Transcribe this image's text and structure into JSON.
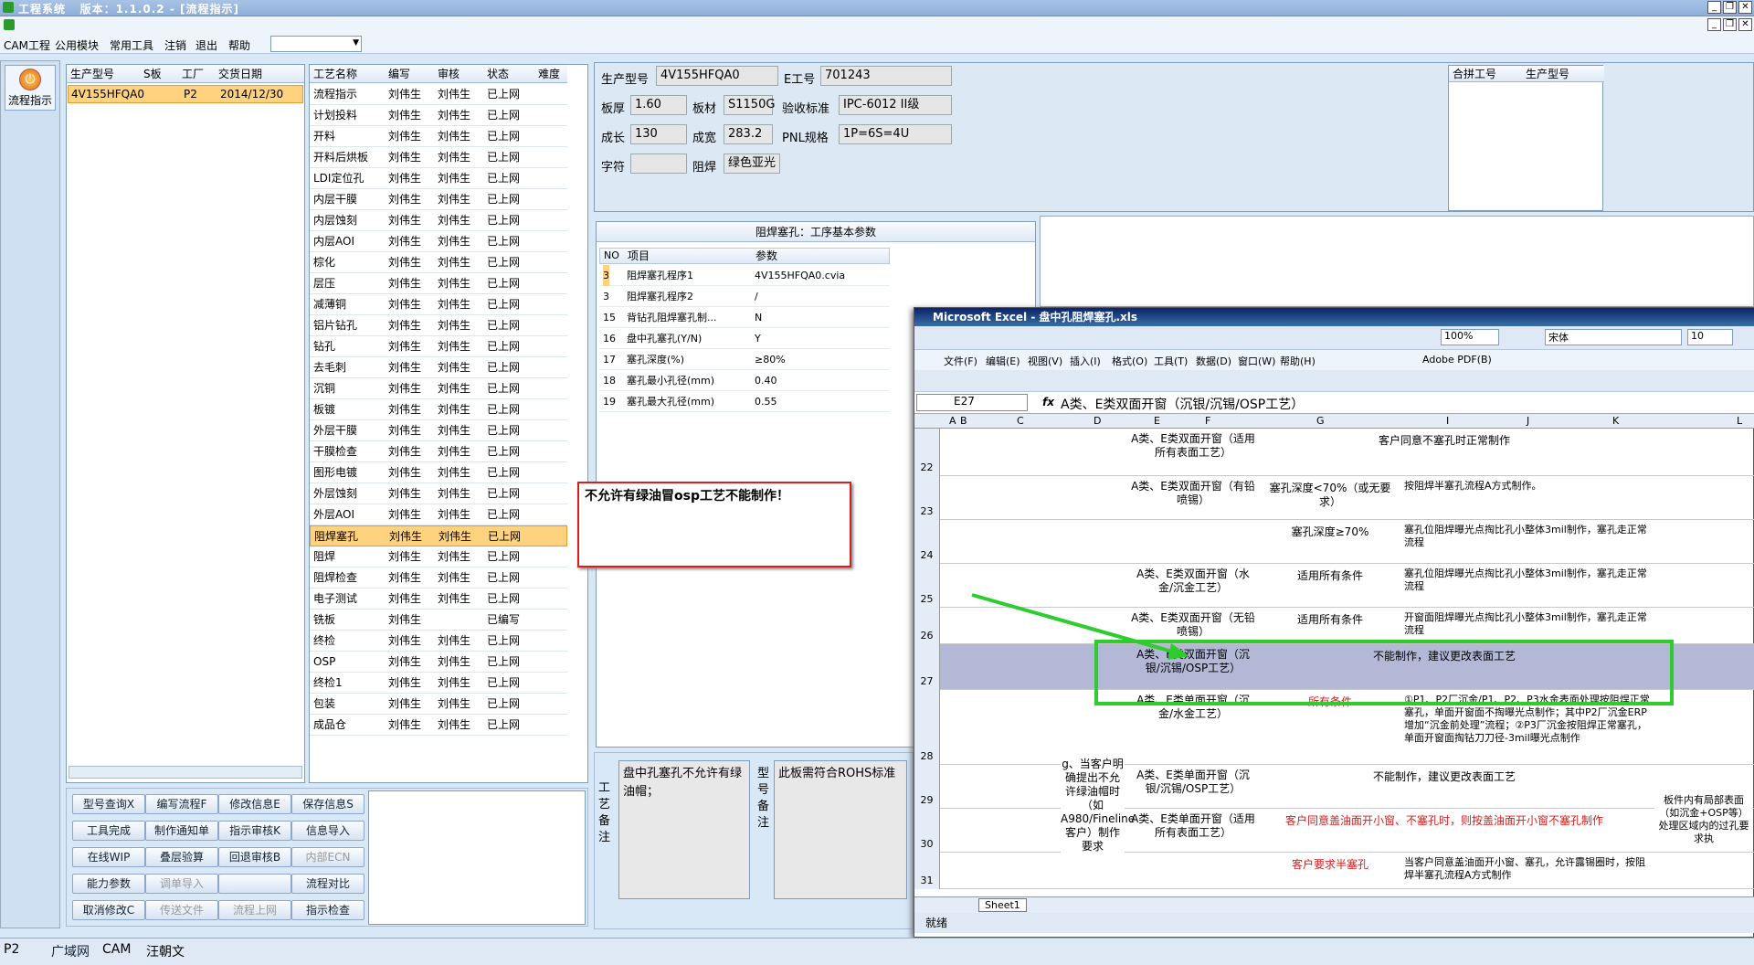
{
  "app": {
    "title": "工程系统",
    "version": "版本：1.1.0.2 - [流程指示]"
  },
  "menu": [
    "CAM工程",
    "公用模块",
    "常用工具",
    "注销",
    "退出",
    "帮助"
  ],
  "left": {
    "flow_btn": "流程指示"
  },
  "orders": {
    "headers": [
      "生产型号",
      "S板",
      "工厂",
      "交货日期"
    ],
    "rows": [
      [
        "4V155HFQA0",
        "",
        "P2",
        "2014/12/30"
      ]
    ]
  },
  "process": {
    "headers": [
      "工艺名称",
      "编写",
      "审核",
      "状态",
      "难度"
    ],
    "rows": [
      [
        "流程指示",
        "刘伟生",
        "刘伟生",
        "已上网"
      ],
      [
        "计划投料",
        "刘伟生",
        "刘伟生",
        "已上网"
      ],
      [
        "开料",
        "刘伟生",
        "刘伟生",
        "已上网"
      ],
      [
        "开料后烘板",
        "刘伟生",
        "刘伟生",
        "已上网"
      ],
      [
        "LDI定位孔",
        "刘伟生",
        "刘伟生",
        "已上网"
      ],
      [
        "内层干膜",
        "刘伟生",
        "刘伟生",
        "已上网"
      ],
      [
        "内层蚀刻",
        "刘伟生",
        "刘伟生",
        "已上网"
      ],
      [
        "内层AOI",
        "刘伟生",
        "刘伟生",
        "已上网"
      ],
      [
        "棕化",
        "刘伟生",
        "刘伟生",
        "已上网"
      ],
      [
        "层压",
        "刘伟生",
        "刘伟生",
        "已上网"
      ],
      [
        "减薄铜",
        "刘伟生",
        "刘伟生",
        "已上网"
      ],
      [
        "铝片钻孔",
        "刘伟生",
        "刘伟生",
        "已上网"
      ],
      [
        "钻孔",
        "刘伟生",
        "刘伟生",
        "已上网"
      ],
      [
        "去毛刺",
        "刘伟生",
        "刘伟生",
        "已上网"
      ],
      [
        "沉铜",
        "刘伟生",
        "刘伟生",
        "已上网"
      ],
      [
        "板镀",
        "刘伟生",
        "刘伟生",
        "已上网"
      ],
      [
        "外层干膜",
        "刘伟生",
        "刘伟生",
        "已上网"
      ],
      [
        "干膜检查",
        "刘伟生",
        "刘伟生",
        "已上网"
      ],
      [
        "图形电镀",
        "刘伟生",
        "刘伟生",
        "已上网"
      ],
      [
        "外层蚀刻",
        "刘伟生",
        "刘伟生",
        "已上网"
      ],
      [
        "外层AOI",
        "刘伟生",
        "刘伟生",
        "已上网"
      ],
      [
        "阻焊塞孔",
        "刘伟生",
        "刘伟生",
        "已上网"
      ],
      [
        "阻焊",
        "刘伟生",
        "刘伟生",
        "已上网"
      ],
      [
        "阻焊检查",
        "刘伟生",
        "刘伟生",
        "已上网"
      ],
      [
        "电子测试",
        "刘伟生",
        "刘伟生",
        "已上网"
      ],
      [
        "铣板",
        "刘伟生",
        "",
        "已编写"
      ],
      [
        "终检",
        "刘伟生",
        "刘伟生",
        "已上网"
      ],
      [
        "OSP",
        "刘伟生",
        "刘伟生",
        "已上网"
      ],
      [
        "终检1",
        "刘伟生",
        "刘伟生",
        "已上网"
      ],
      [
        "包装",
        "刘伟生",
        "刘伟生",
        "已上网"
      ],
      [
        "成品仓",
        "刘伟生",
        "刘伟生",
        "已上网"
      ]
    ]
  },
  "buttons": [
    [
      "型号查询X",
      "编写流程F",
      "修改信息E",
      "保存信息S"
    ],
    [
      "工具完成",
      "制作通知单",
      "指示审核K",
      "信息导入"
    ],
    [
      "在线WIP",
      "叠层验算",
      "回退审核B",
      "内部ECN"
    ],
    [
      "能力参数",
      "调单导入",
      "",
      "流程对比"
    ],
    [
      "取消修改C",
      "传送文件",
      "流程上网",
      "指示检查"
    ]
  ],
  "info": {
    "生产型号": "4V155HFQA0",
    "E工号": "701243",
    "板厚": "1.60",
    "板材": "S1150G",
    "验收标准": "IPC-6012 II级",
    "成长": "130",
    "成宽": "283.2",
    "PNL规格": "1P=6S=4U",
    "字符": "",
    "阻焊": "绿色亚光"
  },
  "merge": {
    "headers": [
      "合拼工号",
      "生产型号"
    ]
  },
  "params": {
    "title": "阻焊塞孔：工序基本参数",
    "headers": [
      "NO",
      "项目",
      "参数"
    ],
    "rows": [
      [
        "3",
        "阻焊塞孔程序1",
        "4V155HFQA0.cvia"
      ],
      [
        "3",
        "阻焊塞孔程序2",
        "/"
      ],
      [
        "15",
        "背钻孔阻焊塞孔制...",
        "N"
      ],
      [
        "16",
        "盘中孔塞孔(Y/N)",
        "Y"
      ],
      [
        "17",
        "塞孔深度(%)",
        "≥80%"
      ],
      [
        "18",
        "塞孔最小孔径(mm)",
        "0.40"
      ],
      [
        "19",
        "塞孔最大孔径(mm)",
        "0.55"
      ]
    ]
  },
  "note": "不允许有绿油冒osp工艺不能制作！",
  "remarks": {
    "label1": "工艺备注",
    "text1": "盘中孔塞孔不允许有绿油帽；",
    "label2": "型号备注",
    "text2": "此板需符合ROHS标准"
  },
  "excel": {
    "title": "Microsoft Excel - 盘中孔阻焊塞孔.xls",
    "menus": [
      "文件(F)",
      "编辑(E)",
      "视图(V)",
      "插入(I)",
      "格式(O)",
      "工具(T)",
      "数据(D)",
      "窗口(W)",
      "帮助(H)",
      "Adobe PDF(B)"
    ],
    "zoom": "100%",
    "font": "宋体",
    "fontsize": "10",
    "cellref": "E27",
    "formula": "A类、E类双面开窗（沉银/沉锡/OSP工艺）",
    "cols": [
      "A",
      "B",
      "C",
      "D",
      "E",
      "F",
      "G",
      "I",
      "J",
      "K",
      "L"
    ],
    "sheet": "Sheet1",
    "status": "就绪",
    "rows": [
      {
        "n": "22",
        "e": "A类、E类双面开窗（适用所有表面工艺）",
        "g": "客户同意不塞孔时正常制作"
      },
      {
        "n": "23",
        "e": "A类、E类双面开窗（有铅喷锡）",
        "g": "塞孔深度<70%（或无要求）",
        "i": "按阻焊半塞孔流程A方式制作。"
      },
      {
        "n": "24",
        "e": "",
        "g": "塞孔深度≥70%",
        "i": "塞孔位阻焊曝光点掏比孔小整体3mil制作，塞孔走正常流程"
      },
      {
        "n": "25",
        "e": "A类、E类双面开窗（水金/沉金工艺）",
        "g": "适用所有条件",
        "i": "塞孔位阻焊曝光点掏比孔小整体3mil制作，塞孔走正常流程"
      },
      {
        "n": "26",
        "e": "A类、E类双面开窗（无铅喷锡）",
        "g": "适用所有条件",
        "i": "开窗面阻焊曝光点掏比孔小整体3mil制作，塞孔走正常流程"
      },
      {
        "n": "27",
        "e": "A类、E类双面开窗（沉银/沉锡/OSP工艺）",
        "g": "不能制作，建议更改表面工艺"
      },
      {
        "n": "28",
        "e": "A类、E类单面开窗（沉金/水金工艺）",
        "g": "所有条件",
        "i": "①P1、P2厂沉金/P1、P2、P3水金表面处理按阻焊正常塞孔，单面开窗面不掏曝光点制作；其中P2厂沉金ERP增加“沉金前处理”流程；②P3厂沉金按阻焊正常塞孔，单面开窗面掏钻刀刀径-3mil曝光点制作"
      },
      {
        "n": "29",
        "e": "A类、E类单面开窗（沉银/沉锡/OSP工艺）",
        "g": "不能制作，建议更改表面工艺"
      },
      {
        "n": "30",
        "e": "A类、E类单面开窗（适用所有表面工艺）",
        "g": "客户同意盖油面开小窗、不塞孔时，则按盖油面开小窗不塞孔制作"
      },
      {
        "n": "31",
        "e": "",
        "g": "客户要求半塞孔",
        "i": "当客户同意盖油面开小窗、塞孔，允许露锡圈时，按阻焊半塞孔流程A方式制作"
      }
    ],
    "d_text": "g、当客户明确提出不允许绿油帽时（如A980/Fineline客户）制作要求",
    "l_text": "板件内有局部表面（如沉金+OSP等）处理区域内的过孔要求执"
  },
  "taskbar": {
    "sel": "P2",
    "items": [
      "广域网",
      "CAM",
      "汪朝文"
    ]
  }
}
